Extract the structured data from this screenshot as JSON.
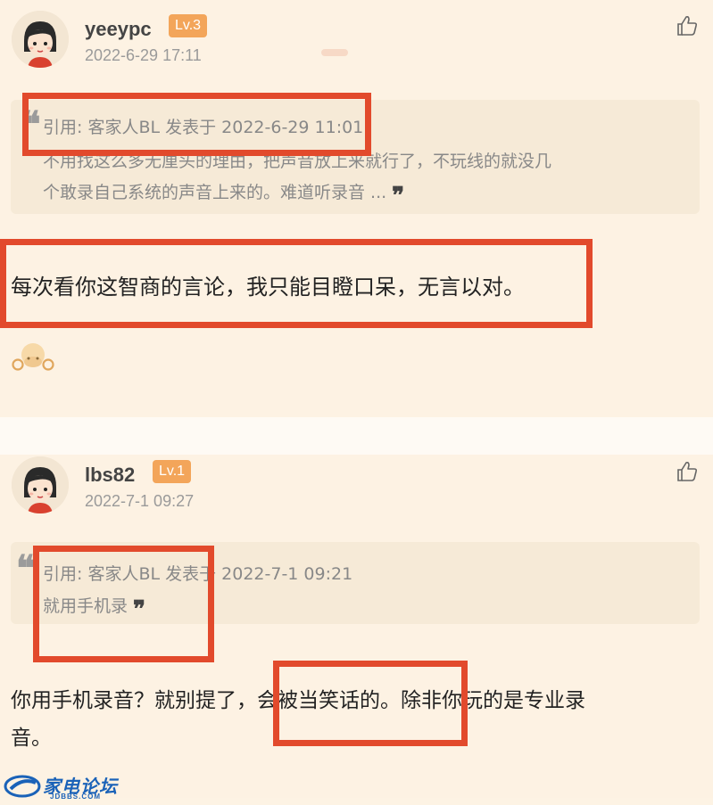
{
  "posts": [
    {
      "username": "yeeypc",
      "level": "Lv.3",
      "time": "2022-6-29 17:11",
      "quote_header": "引用: 客家人BL 发表于 2022-6-29 11:01",
      "quote_line1": "不用找这么多无厘头的理由，把声音放上来就行了，不玩线的就没几",
      "quote_line2": "个敢录自己系统的声音上来的。难道听录音 ...",
      "reply": "每次看你这智商的言论，我只能目瞪口呆，无言以对。"
    },
    {
      "username": "lbs82",
      "level": "Lv.1",
      "time": "2022-7-1 09:27",
      "quote_header": "引用: 客家人BL 发表于 2022-7-1 09:21",
      "quote_line1": "就用手机录",
      "reply_part1": "你用手机录音？就别提了，",
      "reply_part2": "会被当笑话的。",
      "reply_part3": "除非你玩的是专业录",
      "reply_line2": "音。"
    }
  ],
  "quote_close_mark": "❞",
  "quote_open_mark": "❝",
  "watermark": {
    "name": "家电论坛",
    "url": "JDBBS.COM"
  },
  "colors": {
    "highlight": "#e24a2c",
    "level_badge": "#f3a55a",
    "background": "#fdf2e3"
  }
}
